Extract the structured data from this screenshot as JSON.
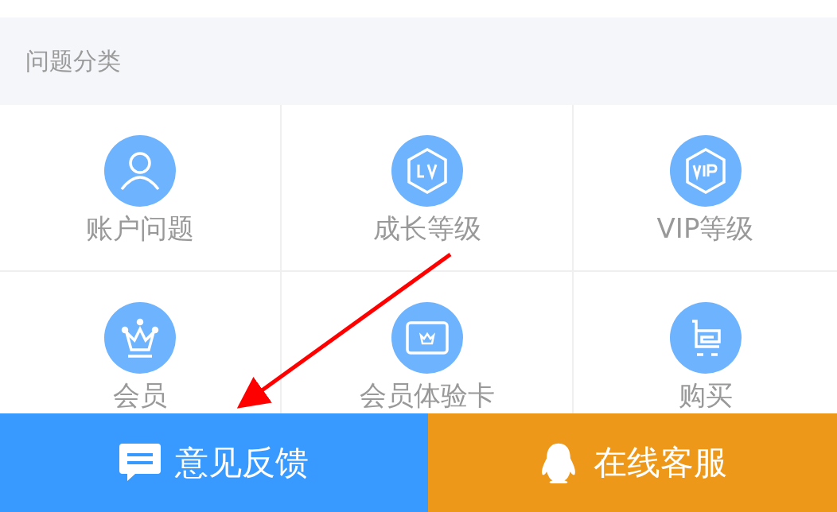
{
  "section_title": "问题分类",
  "categories": [
    {
      "label": "账户问题",
      "kind": "user"
    },
    {
      "label": "成长等级",
      "kind": "lv"
    },
    {
      "label": "VIP等级",
      "kind": "vip"
    },
    {
      "label": "会员",
      "kind": "crown"
    },
    {
      "label": "会员体验卡",
      "kind": "card"
    },
    {
      "label": "购买",
      "kind": "cart"
    }
  ],
  "bottom_bar": [
    {
      "label": "意见反馈",
      "kind": "feedback"
    },
    {
      "label": "在线客服",
      "kind": "service"
    }
  ]
}
